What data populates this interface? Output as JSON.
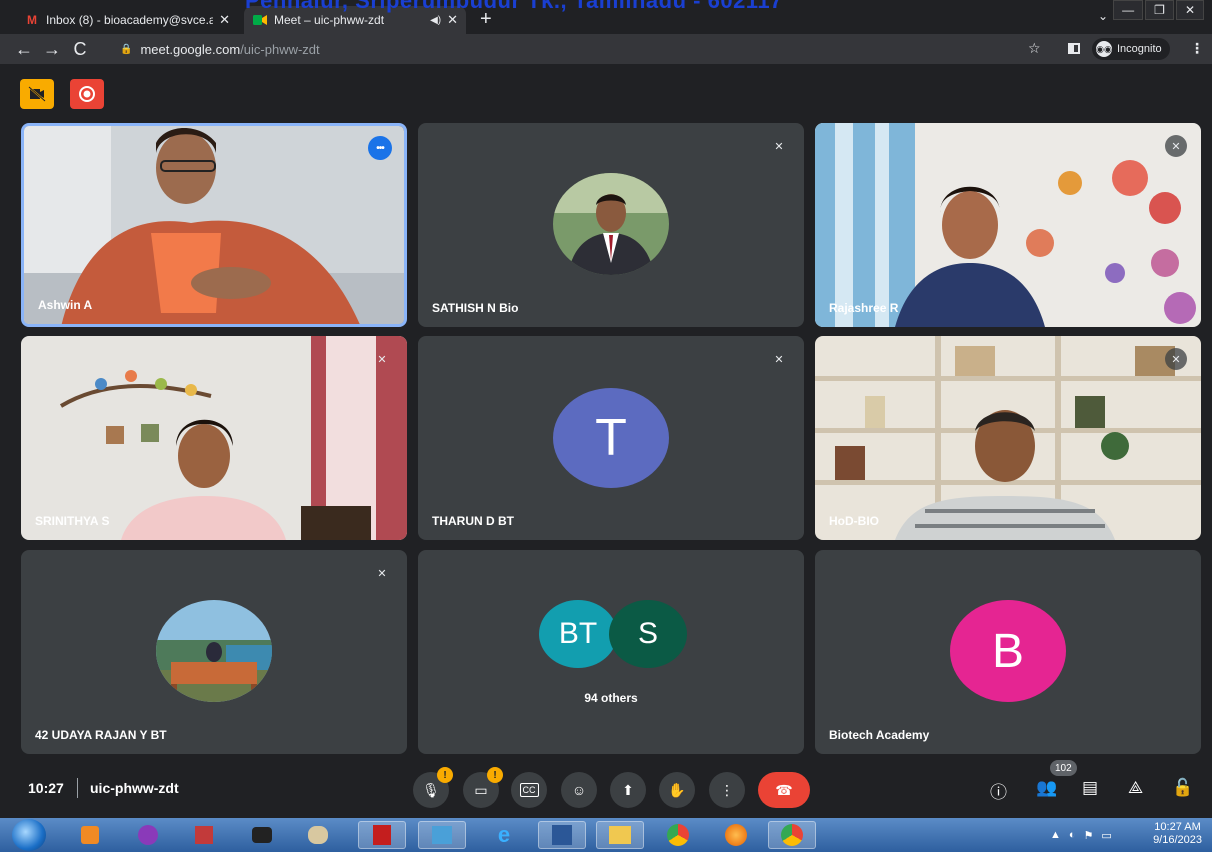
{
  "overlay_heading": "Pennalur, Sriperumbudur Tk., Tamilnadu - 602117",
  "browser": {
    "tabs": [
      {
        "label": "Inbox (8) - bioacademy@svce.ac",
        "favicon": "gmail-icon"
      },
      {
        "label": "Meet – uic-phww-zdt",
        "favicon": "meet-icon"
      }
    ],
    "url_domain": "meet.google.com",
    "url_path": "/uic-phww-zdt",
    "incognito_label": "Incognito"
  },
  "tiles": [
    {
      "name": "Ashwin A",
      "type": "video",
      "speaking": true
    },
    {
      "name": "SATHISH N Bio",
      "type": "photo-avatar",
      "muted": true
    },
    {
      "name": "Rajashree R",
      "type": "video",
      "muted": true
    },
    {
      "name": "SRINITHYA S",
      "type": "video",
      "muted": true
    },
    {
      "name": "THARUN D BT",
      "type": "letter-avatar",
      "initial": "T",
      "color": "#5c6bc0",
      "muted": true
    },
    {
      "name": "HoD-BIO",
      "type": "video",
      "muted": true
    },
    {
      "name": "42 UDAYA RAJAN Y BT",
      "type": "photo-avatar",
      "muted": true
    },
    {
      "name": "",
      "type": "group",
      "avatars": [
        {
          "initial": "BT",
          "color": "#129eaf"
        },
        {
          "initial": "S",
          "color": "#0b5a45"
        }
      ],
      "others_label": "94 others"
    },
    {
      "name": "Biotech Academy",
      "type": "letter-avatar",
      "initial": "B",
      "color": "#e52592"
    }
  ],
  "bottom_bar": {
    "time": "10:27",
    "meeting_code": "uic-phww-zdt",
    "participants_count": "102"
  },
  "taskbar": {
    "clock_time": "10:27 AM",
    "clock_date": "9/16/2023"
  },
  "colors": {
    "accent_blue": "#8ab4f8",
    "leave_red": "#ea4335",
    "warning_yellow": "#f9ab00"
  }
}
